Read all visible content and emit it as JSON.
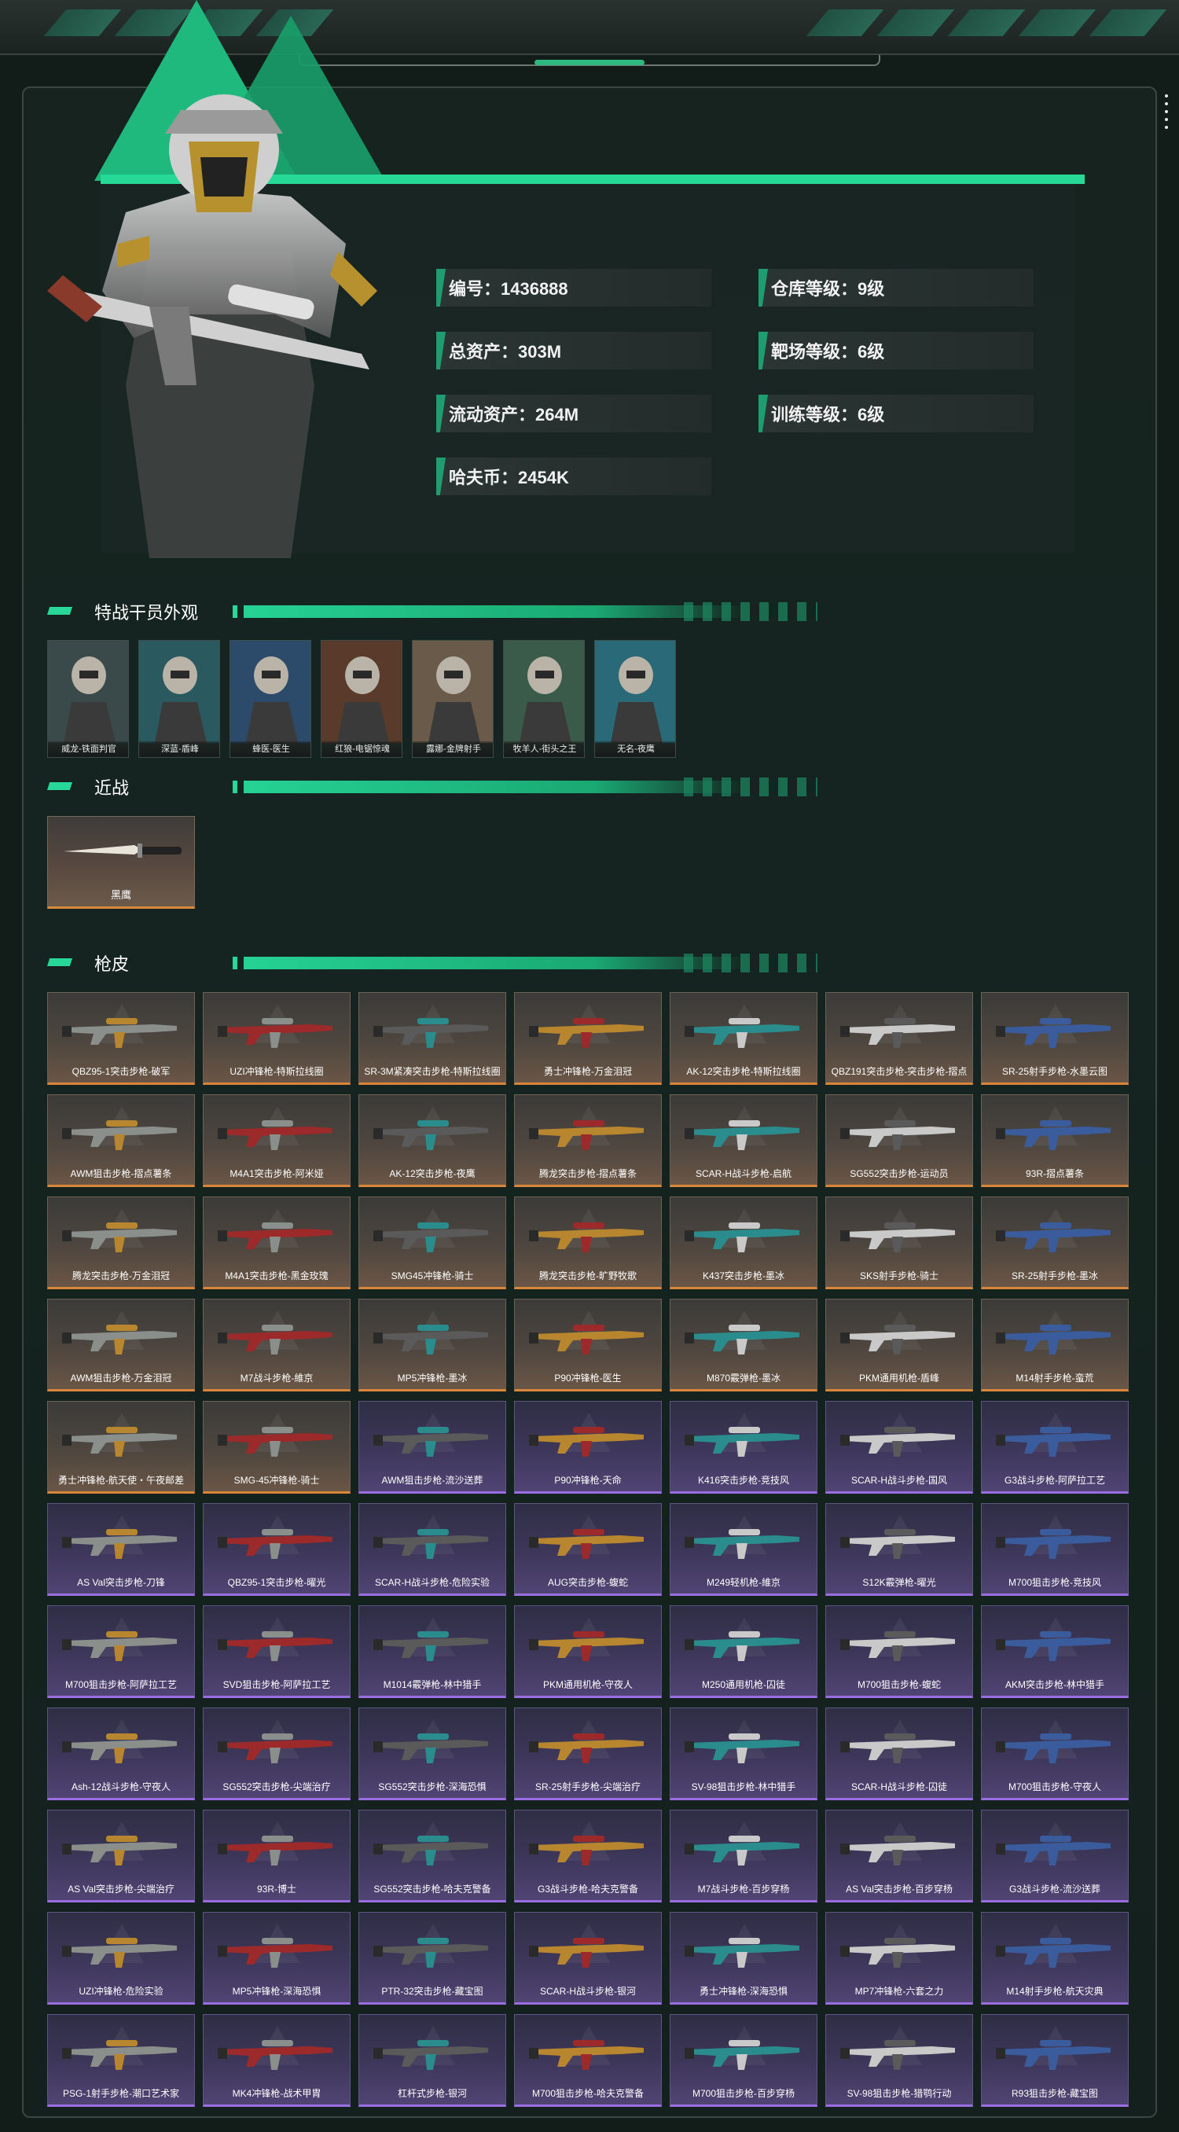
{
  "player": {
    "stats": [
      {
        "label": "编号：1436888"
      },
      {
        "label": "总资产：303M"
      },
      {
        "label": "流动资产：264M"
      },
      {
        "label": "哈夫币：2454K"
      },
      {
        "label": "仓库等级：9级"
      },
      {
        "label": "靶场等级：6级"
      },
      {
        "label": "训练等级：6级"
      }
    ]
  },
  "sections": {
    "operators_title": "特战干员外观",
    "melee_title": "近战",
    "skins_title": "枪皮"
  },
  "operators": [
    {
      "name": "威龙-铁面判官",
      "color": "#3a4a4a"
    },
    {
      "name": "深蓝-盾峰",
      "color": "#2a5a60"
    },
    {
      "name": "蜂医-医生",
      "color": "#2c4a6a"
    },
    {
      "name": "红狼-电锯惊魂",
      "color": "#5a3a2a"
    },
    {
      "name": "露娜-金牌射手",
      "color": "#6a5a4a"
    },
    {
      "name": "牧羊人-街头之王",
      "color": "#3a5a4a"
    },
    {
      "name": "无名-夜鹰",
      "color": "#2a6a78"
    }
  ],
  "melee": [
    {
      "name": "黑鹰"
    }
  ],
  "weapons": [
    {
      "name": "QBZ95-1突击步枪-破军",
      "rarity": "gold"
    },
    {
      "name": "UZI冲锋枪-特斯拉线圈",
      "rarity": "gold"
    },
    {
      "name": "SR-3M紧凑突击步枪-特斯拉线圈",
      "rarity": "gold"
    },
    {
      "name": "勇士冲锋枪-万金泪冠",
      "rarity": "gold"
    },
    {
      "name": "AK-12突击步枪-特斯拉线圈",
      "rarity": "gold"
    },
    {
      "name": "QBZ191突击步枪-突击步枪-摺点",
      "rarity": "gold"
    },
    {
      "name": "SR-25射手步枪-水墨云图",
      "rarity": "gold"
    },
    {
      "name": "AWM狙击步枪-摺点薯条",
      "rarity": "gold"
    },
    {
      "name": "M4A1突击步枪-阿米娅",
      "rarity": "gold"
    },
    {
      "name": "AK-12突击步枪-夜鹰",
      "rarity": "gold"
    },
    {
      "name": "腾龙突击步枪-摺点薯条",
      "rarity": "gold"
    },
    {
      "name": "SCAR-H战斗步枪-启航",
      "rarity": "gold"
    },
    {
      "name": "SG552突击步枪-运动员",
      "rarity": "gold"
    },
    {
      "name": "93R-摺点薯条",
      "rarity": "gold"
    },
    {
      "name": "腾龙突击步枪-万金泪冠",
      "rarity": "gold"
    },
    {
      "name": "M4A1突击步枪-黑金玫瑰",
      "rarity": "gold"
    },
    {
      "name": "SMG45冲锋枪-骑士",
      "rarity": "gold"
    },
    {
      "name": "腾龙突击步枪-旷野牧歌",
      "rarity": "gold"
    },
    {
      "name": "K437突击步枪-墨冰",
      "rarity": "gold"
    },
    {
      "name": "SKS射手步枪-骑士",
      "rarity": "gold"
    },
    {
      "name": "SR-25射手步枪-墨冰",
      "rarity": "gold"
    },
    {
      "name": "AWM狙击步枪-万金泪冠",
      "rarity": "gold"
    },
    {
      "name": "M7战斗步枪-維京",
      "rarity": "gold"
    },
    {
      "name": "MP5冲锋枪-墨冰",
      "rarity": "gold"
    },
    {
      "name": "P90冲锋枪-医生",
      "rarity": "gold"
    },
    {
      "name": "M870霰弹枪-墨冰",
      "rarity": "gold"
    },
    {
      "name": "PKM通用机枪-盾峰",
      "rarity": "gold"
    },
    {
      "name": "M14射手步枪-蛮荒",
      "rarity": "gold"
    },
    {
      "name": "勇士冲锋枪-航天使・午夜邮差",
      "rarity": "gold"
    },
    {
      "name": "SMG-45冲锋枪-骑士",
      "rarity": "gold"
    },
    {
      "name": "AWM狙击步枪-流沙送葬",
      "rarity": "purple"
    },
    {
      "name": "P90冲锋枪-天命",
      "rarity": "purple"
    },
    {
      "name": "K416突击步枪-竞技风",
      "rarity": "purple"
    },
    {
      "name": "SCAR-H战斗步枪-国风",
      "rarity": "purple"
    },
    {
      "name": "G3战斗步枪-阿萨拉工艺",
      "rarity": "purple"
    },
    {
      "name": "AS Val突击步枪-刀锋",
      "rarity": "purple"
    },
    {
      "name": "QBZ95-1突击步枪-曜光",
      "rarity": "purple"
    },
    {
      "name": "SCAR-H战斗步枪-危险实验",
      "rarity": "purple"
    },
    {
      "name": "AUG突击步枪-蝮蛇",
      "rarity": "purple"
    },
    {
      "name": "M249轻机枪-維京",
      "rarity": "purple"
    },
    {
      "name": "S12K霰弹枪-曜光",
      "rarity": "purple"
    },
    {
      "name": "M700狙击步枪-竞技风",
      "rarity": "purple"
    },
    {
      "name": "M700狙击步枪-阿萨拉工艺",
      "rarity": "purple"
    },
    {
      "name": "SVD狙击步枪-阿萨拉工艺",
      "rarity": "purple"
    },
    {
      "name": "M1014霰弹枪-林中猎手",
      "rarity": "purple"
    },
    {
      "name": "PKM通用机枪-守夜人",
      "rarity": "purple"
    },
    {
      "name": "M250通用机枪-囚徒",
      "rarity": "purple"
    },
    {
      "name": "M700狙击步枪-蝮蛇",
      "rarity": "purple"
    },
    {
      "name": "AKM突击步枪-林中猎手",
      "rarity": "purple"
    },
    {
      "name": "Ash-12战斗步枪-守夜人",
      "rarity": "purple"
    },
    {
      "name": "SG552突击步枪-尖端治疗",
      "rarity": "purple"
    },
    {
      "name": "SG552突击步枪-深海恐惧",
      "rarity": "purple"
    },
    {
      "name": "SR-25射手步枪-尖端治疗",
      "rarity": "purple"
    },
    {
      "name": "SV-98狙击步枪-林中猎手",
      "rarity": "purple"
    },
    {
      "name": "SCAR-H战斗步枪-囚徒",
      "rarity": "purple"
    },
    {
      "name": "M700狙击步枪-守夜人",
      "rarity": "purple"
    },
    {
      "name": "AS Val突击步枪-尖端治疗",
      "rarity": "purple"
    },
    {
      "name": "93R-博士",
      "rarity": "purple"
    },
    {
      "name": "SG552突击步枪-哈夫克警备",
      "rarity": "purple"
    },
    {
      "name": "G3战斗步枪-哈夫克警备",
      "rarity": "purple"
    },
    {
      "name": "M7战斗步枪-百步穿杨",
      "rarity": "purple"
    },
    {
      "name": "AS Val突击步枪-百步穿杨",
      "rarity": "purple"
    },
    {
      "name": "G3战斗步枪-流沙送葬",
      "rarity": "purple"
    },
    {
      "name": "UZI冲锋枪-危险实验",
      "rarity": "purple"
    },
    {
      "name": "MP5冲锋枪-深海恐惧",
      "rarity": "purple"
    },
    {
      "name": "PTR-32突击步枪-藏宝图",
      "rarity": "purple"
    },
    {
      "name": "SCAR-H战斗步枪-银河",
      "rarity": "purple"
    },
    {
      "name": "勇士冲锋枪-深海恐惧",
      "rarity": "purple"
    },
    {
      "name": "MP7冲锋枪-六套之力",
      "rarity": "purple"
    },
    {
      "name": "M14射手步枪-航天灾典",
      "rarity": "purple"
    },
    {
      "name": "PSG-1射手步枪-潮口艺术家",
      "rarity": "purple"
    },
    {
      "name": "MK4冲锋枪-战术甲胄",
      "rarity": "purple"
    },
    {
      "name": "杠杆式步枪-银河",
      "rarity": "purple"
    },
    {
      "name": "M700狙击步枪-哈夫克警备",
      "rarity": "purple"
    },
    {
      "name": "M700狙击步枪-百步穿杨",
      "rarity": "purple"
    },
    {
      "name": "SV-98狙击步枪-猎鹗行动",
      "rarity": "purple"
    },
    {
      "name": "R93狙击步枪-藏宝图",
      "rarity": "purple"
    }
  ]
}
